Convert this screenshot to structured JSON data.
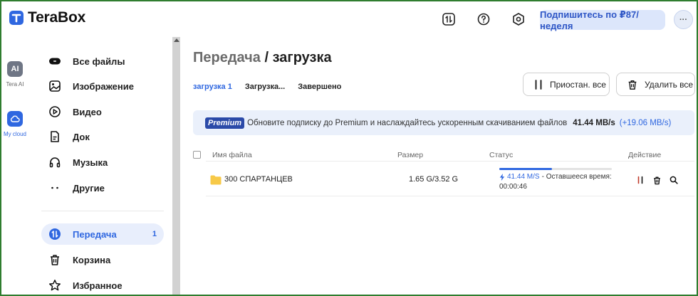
{
  "app": {
    "name": "TeraBox"
  },
  "topbar": {
    "subscribe_label": "Подпишитесь по ₽87/неделя",
    "avatar_text": "···",
    "icons": [
      "transfer-icon",
      "help-icon",
      "settings-icon"
    ]
  },
  "rail": {
    "items": [
      {
        "label": "Tera AI",
        "badge": "AI",
        "color": "#6f7685"
      },
      {
        "label": "My cloud",
        "color": "#2f67e0",
        "active": true
      }
    ]
  },
  "sidebar": {
    "items": [
      {
        "label": "Все файлы",
        "icon": "all-files-icon"
      },
      {
        "label": "Изображение",
        "icon": "image-icon"
      },
      {
        "label": "Видео",
        "icon": "video-icon"
      },
      {
        "label": "Док",
        "icon": "document-icon"
      },
      {
        "label": "Музыка",
        "icon": "headphones-icon"
      },
      {
        "label": "Другие",
        "icon": "more-dots-icon"
      },
      {
        "label": "Передача",
        "icon": "transfer-icon",
        "count": "1",
        "active": true
      },
      {
        "label": "Корзина",
        "icon": "trash-icon"
      },
      {
        "label": "Избранное",
        "icon": "star-icon"
      }
    ]
  },
  "main": {
    "title_part1": "Передача",
    "title_sep": " / ",
    "title_part2": "загрузка",
    "tabs": [
      {
        "label": "загрузка 1",
        "active": true
      },
      {
        "label": "Загрузка..."
      },
      {
        "label": "Завершено"
      }
    ],
    "pause_all_label": "Приостан. все",
    "delete_all_label": "Удалить все",
    "banner": {
      "badge": "Premium",
      "text": "Обновите подписку до Premium и наслаждайтесь ускоренным скачиванием файлов",
      "speed": "41.44 MB/s",
      "delta": "(+19.06 MB/s)"
    },
    "table": {
      "headers": {
        "name": "Имя файла",
        "size": "Размер",
        "status": "Статус",
        "action": "Действие"
      },
      "rows": [
        {
          "name": "300 СПАРТАНЦЕВ",
          "size": "1.65 G/3.52 G",
          "speed": "41.44 M/S",
          "remaining_label": "- Оставшееся время:",
          "remaining": "00:00:46",
          "progress": 0.47
        }
      ]
    }
  },
  "colors": {
    "accent": "#2f67e0",
    "folder": "#f7c948",
    "premium_badge": "#2b4aa8"
  }
}
